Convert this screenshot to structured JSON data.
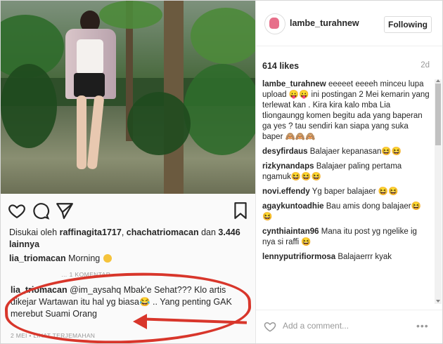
{
  "post": {
    "likes_line_prefix": "Disukai oleh",
    "liker1": "raffinagita1717",
    "liker2": "chachatriomacan",
    "likes_rest": "dan",
    "likes_count": "3.446 lainnya",
    "caption_user": "lia_triomacan",
    "caption_text": "Morning",
    "hidden_label": "… 1 KOMENTAR",
    "reply_user": "lia_triomacan",
    "reply_mention": "@im_aysahq",
    "reply_text": "Mbak'e Sehat??? Klo artis dikejar Wartawan itu hal yg biasa😂 .. Yang penting GAK merebut Suami Orang",
    "reply_date": "2 MEI",
    "reply_translate": "LIHAT TERJEMAHAN"
  },
  "header": {
    "username": "lambe_turahnew",
    "follow_label": "Following"
  },
  "stats": {
    "likes": "614 likes",
    "age": "2d"
  },
  "comments": [
    {
      "user": "lambe_turahnew",
      "text": "eeeeet eeeeh minceu lupa upload 😛😛 ini postingan 2 Mei kemarin yang terlewat kan . Kira kira kalo mba Lia tliongaungg komen begitu ada yang baperan ga yes ? tau sendiri kan siapa yang suka baper 🙈🙈🙈"
    },
    {
      "user": "desyfirdaus",
      "text": "Balajaer kepanasan😆😆"
    },
    {
      "user": "rizkynandaps",
      "text": "Balajaer paling pertama ngamuk😆😆😆"
    },
    {
      "user": "novi.effendy",
      "text": "Yg baper balajaer 😆😆"
    },
    {
      "user": "agaykuntoadhie",
      "text": "Bau amis dong balajaer😆😆"
    },
    {
      "user": "cynthiaintan96",
      "text": "Mana itu post yg ngelike ig nya si raffi 😆"
    },
    {
      "user": "lennyputrifiormosa",
      "text": "Balajaerrr kyak"
    }
  ],
  "footer": {
    "placeholder": "Add a comment...",
    "more": "•••"
  },
  "icons": [
    "heart-icon",
    "comment-icon",
    "share-icon",
    "bookmark-icon",
    "more-icon"
  ],
  "colors": {
    "accent_red": "#d8362b",
    "muted": "#999999"
  }
}
